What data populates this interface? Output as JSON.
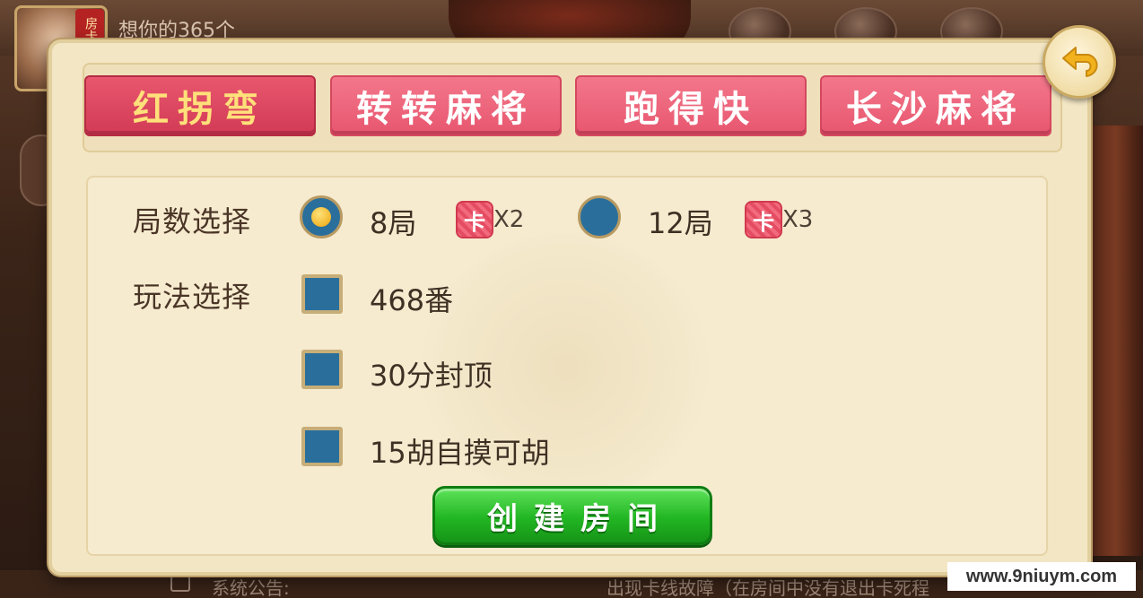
{
  "background": {
    "username": "想你的365个",
    "avatar_badge": "房卡",
    "notice_label": "系统公告:",
    "notice_text": "出现卡线故障（在房间中没有退出卡死程"
  },
  "tabs": [
    {
      "label": "红拐弯",
      "active": true
    },
    {
      "label": "转转麻将",
      "active": false
    },
    {
      "label": "跑得快",
      "active": false
    },
    {
      "label": "长沙麻将",
      "active": false
    }
  ],
  "rounds": {
    "label": "局数选择",
    "options": [
      {
        "text": "8局",
        "card": "卡",
        "multiplier": "X2",
        "selected": true
      },
      {
        "text": "12局",
        "card": "卡",
        "multiplier": "X3",
        "selected": false
      }
    ]
  },
  "rules": {
    "label": "玩法选择",
    "options": [
      {
        "text": "468番"
      },
      {
        "text": "30分封顶"
      },
      {
        "text": "15胡自摸可胡"
      }
    ]
  },
  "create_button": {
    "label": "创建房间"
  },
  "site_watermark": "www.9niuym.com",
  "colors": {
    "tab_active": "#d23a55",
    "tab_active_text": "#ffe07a",
    "tab_inactive": "#e7566f",
    "radio_fill": "#2a6f9c",
    "create_button": "#22b623",
    "dialog_bg": "#f3e6c4"
  }
}
